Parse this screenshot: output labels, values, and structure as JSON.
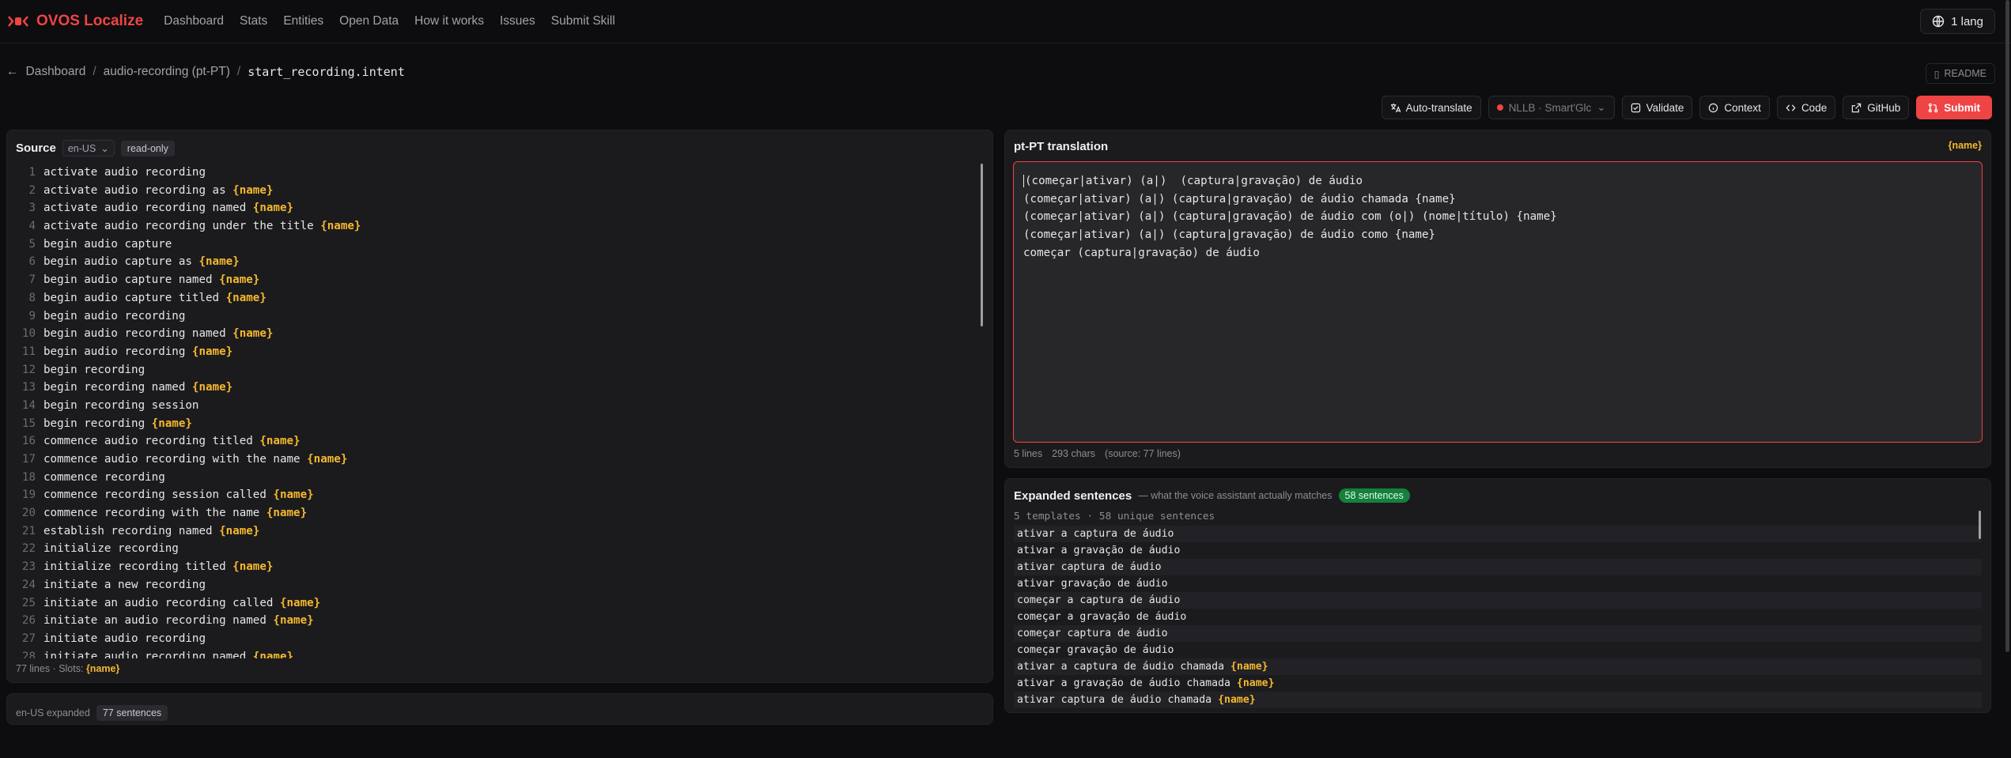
{
  "app": {
    "brand": "OVOS Localize"
  },
  "nav": {
    "links": [
      "Dashboard",
      "Stats",
      "Entities",
      "Open Data",
      "How it works",
      "Issues",
      "Submit Skill"
    ],
    "lang_button": "1 lang"
  },
  "breadcrumb": {
    "back": "Dashboard",
    "skill": "audio-recording (pt-PT)",
    "current": "start_recording.intent"
  },
  "readme_label": "README",
  "toolbar": {
    "auto_translate": "Auto-translate",
    "engine": "NLLB · Smart'Glc",
    "validate": "Validate",
    "context": "Context",
    "code": "Code",
    "github": "GitHub",
    "submit": "Submit"
  },
  "source_panel": {
    "title": "Source",
    "lang": "en-US",
    "badge": "read-only",
    "lines": [
      [
        "activate audio recording",
        ""
      ],
      [
        "activate audio recording as ",
        "{name}"
      ],
      [
        "activate audio recording named ",
        "{name}"
      ],
      [
        "activate audio recording under the title ",
        "{name}"
      ],
      [
        "begin audio capture",
        ""
      ],
      [
        "begin audio capture as ",
        "{name}"
      ],
      [
        "begin audio capture named ",
        "{name}"
      ],
      [
        "begin audio capture titled ",
        "{name}"
      ],
      [
        "begin audio recording",
        ""
      ],
      [
        "begin audio recording named ",
        "{name}"
      ],
      [
        "begin audio recording ",
        "{name}"
      ],
      [
        "begin recording",
        ""
      ],
      [
        "begin recording named ",
        "{name}"
      ],
      [
        "begin recording session",
        ""
      ],
      [
        "begin recording ",
        "{name}"
      ],
      [
        "commence audio recording titled ",
        "{name}"
      ],
      [
        "commence audio recording with the name ",
        "{name}"
      ],
      [
        "commence recording",
        ""
      ],
      [
        "commence recording session called ",
        "{name}"
      ],
      [
        "commence recording with the name ",
        "{name}"
      ],
      [
        "establish recording named ",
        "{name}"
      ],
      [
        "initialize recording",
        ""
      ],
      [
        "initialize recording titled ",
        "{name}"
      ],
      [
        "initiate a new recording",
        ""
      ],
      [
        "initiate an audio recording called ",
        "{name}"
      ],
      [
        "initiate an audio recording named ",
        "{name}"
      ],
      [
        "initiate audio recording",
        ""
      ],
      [
        "initiate audio recording named ",
        "{name}"
      ]
    ],
    "footer_text": "77 lines · Slots: ",
    "footer_slot": "{name}"
  },
  "expanded_source": {
    "label": "en-US expanded",
    "badge": "77 sentences"
  },
  "translation_panel": {
    "title": "pt-PT translation",
    "slot_tag": "{name}",
    "lines": [
      "(começar|ativar) (a|)  (captura|gravação) de áudio",
      "(começar|ativar) (a|) (captura|gravação) de áudio chamada {name}",
      "(começar|ativar) (a|) (captura|gravação) de áudio com (o|) (nome|título) {name}",
      "(começar|ativar) (a|) (captura|gravação) de áudio como {name}",
      "começar (captura|gravação) de áudio"
    ],
    "footer": [
      "5 lines",
      "293 chars",
      "(source: 77 lines)"
    ]
  },
  "expanded_panel": {
    "title": "Expanded sentences",
    "subtitle": "— what the voice assistant actually matches",
    "badge": "58 sentences",
    "stats": "5 templates · 58 unique sentences",
    "rows": [
      [
        "ativar a captura de áudio",
        ""
      ],
      [
        "ativar a gravação de áudio",
        ""
      ],
      [
        "ativar captura de áudio",
        ""
      ],
      [
        "ativar gravação de áudio",
        ""
      ],
      [
        "começar a captura de áudio",
        ""
      ],
      [
        "começar a gravação de áudio",
        ""
      ],
      [
        "começar captura de áudio",
        ""
      ],
      [
        "começar gravação de áudio",
        ""
      ],
      [
        "ativar a captura de áudio chamada ",
        "{name}"
      ],
      [
        "ativar a gravação de áudio chamada ",
        "{name}"
      ],
      [
        "ativar captura de áudio chamada ",
        "{name}"
      ]
    ]
  },
  "colors": {
    "accent": "#ef4444",
    "slot": "#f5b82e",
    "success": "#15803d"
  }
}
